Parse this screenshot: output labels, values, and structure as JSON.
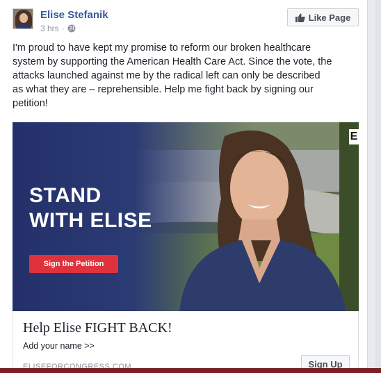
{
  "post": {
    "author": "Elise Stefanik",
    "time": "3 hrs",
    "privacy_separator": "·",
    "like_page_label": "Like Page",
    "text": "I'm proud to have kept my promise to reform our broken healthcare\nsystem by supporting the American Health Care Act. Since the vote, the\nattacks launched against me by the radical left can only be described\nas what they are – reprehensible. Help me fight back by signing our\npetition!"
  },
  "ad": {
    "image_headline": "STAND\nWITH ELISE",
    "image_button_label": "Sign the Petition",
    "image_logo_text": "E",
    "headline": "Help Elise FIGHT BACK!",
    "description": "Add your name >>",
    "domain": "ELISEFORCONGRESS.COM",
    "cta_label": "Sign Up"
  },
  "colors": {
    "link_blue": "#365899",
    "ad_navy": "#2b3b73",
    "petition_red": "#e0323d"
  },
  "icons": {
    "like": "thumbs-up-icon",
    "privacy": "globe-icon"
  }
}
